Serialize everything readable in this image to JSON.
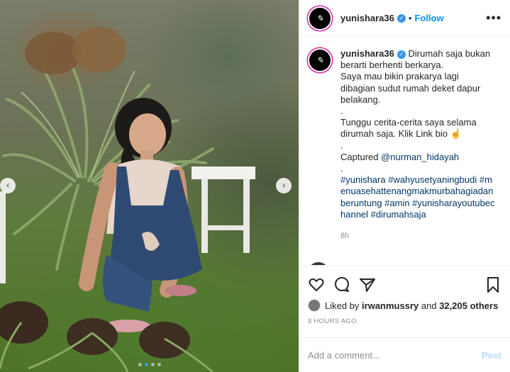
{
  "photo": {
    "prev_icon": "chevron-left-icon",
    "next_icon": "chevron-right-icon",
    "slide_count": 4,
    "active_slide": 1
  },
  "header": {
    "username": "yunishara36",
    "verified": true,
    "separator": "•",
    "follow_label": "Follow",
    "more_label": "•••"
  },
  "caption": {
    "username": "yunishara36",
    "lines": [
      "Dirumah saja bukan berarti berhenti berkarya.",
      "Saya mau bikin prakarya lagi dibagian sudut rumah deket dapur belakang.",
      ".",
      "Tunggu cerita-cerita saya selama dirumah saja. Klik Link bio ☝",
      ".",
      "Captured",
      "@nurman_hidayah",
      ".",
      "#yunishara #wahyusetyaningbudi #menuasehattenangmakmurbahagiadanberuntung #amin #yunisharayoutubechannel #dirumahsaja"
    ],
    "time": "8h"
  },
  "actions": {
    "like_icon": "heart-icon",
    "comment_icon": "comment-icon",
    "share_icon": "share-icon",
    "save_icon": "bookmark-icon"
  },
  "likes": {
    "prefix": "Liked by",
    "user": "irwanmussry",
    "middle": "and",
    "count": "32,205 others"
  },
  "posted_ago": "8 HOURS AGO",
  "comment_box": {
    "placeholder": "Add a comment...",
    "post_label": "Post"
  },
  "colors": {
    "accent": "#0095f6",
    "verified": "#3897f0",
    "muted": "#8e8e8e"
  }
}
